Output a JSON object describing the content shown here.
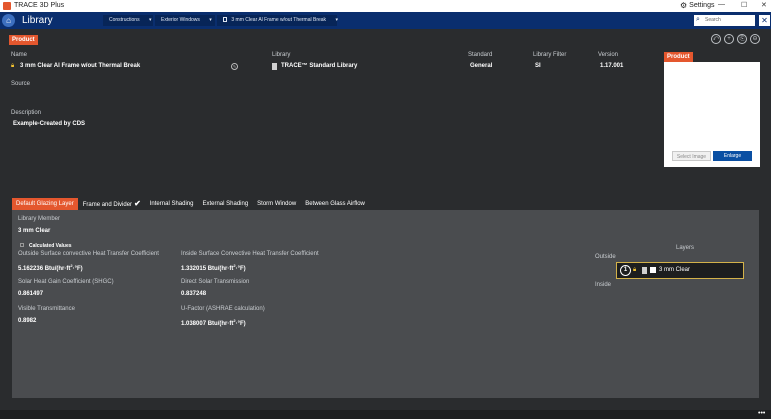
{
  "window": {
    "app_title": "TRACE 3D Plus",
    "settings_label": "Settings",
    "minimize": "—",
    "maximize": "☐",
    "close": "✕"
  },
  "header": {
    "page_title": "Library",
    "breadcrumbs": [
      {
        "label": "Constructions"
      },
      {
        "label": "Exterior Windows"
      },
      {
        "label": "3 mm Clear Al Frame w/out Thermal Break"
      }
    ],
    "search_placeholder": "Search",
    "close_label": "✕"
  },
  "product": {
    "badge": "Product",
    "name_label": "Name",
    "name_value": "3 mm Clear Al Frame w/out Thermal Break",
    "library_label": "Library",
    "library_value": "TRACE™ Standard Library",
    "standard_label": "Standard",
    "standard_value": "General",
    "filter_label": "Library Filter",
    "filter_value": "SI",
    "version_label": "Version",
    "version_value": "1.17.001",
    "source_label": "Source",
    "description_label": "Description",
    "description_value": "Example-Created by CDS",
    "image_badge": "Product",
    "select_image": "Select Image",
    "enlarge": "Enlarge"
  },
  "actions": [
    {
      "icon": "back-icon",
      "glyph": "⤺"
    },
    {
      "icon": "add-icon",
      "glyph": "+"
    },
    {
      "icon": "copy-icon",
      "glyph": "⎘"
    },
    {
      "icon": "delete-icon",
      "glyph": "⊖"
    }
  ],
  "tabs": [
    {
      "label": "Default Glazing Layer",
      "active": true
    },
    {
      "label": "Frame and Divider",
      "check": "✔"
    },
    {
      "label": "Internal Shading"
    },
    {
      "label": "External Shading"
    },
    {
      "label": "Storm Window"
    },
    {
      "label": "Between Glass Airflow"
    }
  ],
  "layer": {
    "member_label": "Library Member",
    "member_value": "3 mm Clear",
    "calculated_label": "Calculated Values",
    "outside_conv_label": "Outside Surface convective Heat Transfer Coefficient",
    "outside_conv_value": "5.162236 Btu/(hr·ft",
    "outside_conv_unit": "·°F)",
    "inside_conv_label": "Inside Surface Convective Heat Transfer Coefficient",
    "inside_conv_value": "1.332015 Btu/(hr·ft",
    "inside_conv_unit": "·°F)",
    "shgc_label": "Solar Heat Gain Coefficient (SHGC)",
    "shgc_value": "0.861497",
    "dst_label": "Direct Solar Transmission",
    "dst_value": "0.837248",
    "vt_label": "Visible Transmittance",
    "vt_value": "0.8982",
    "ufactor_label": "U-Factor (ASHRAE calculation)",
    "ufactor_value": "1.038007 Btu/(hr·ft",
    "ufactor_unit": "·°F)",
    "sup2": "2"
  },
  "layers_panel": {
    "title": "Layers",
    "outside_label": "Outside",
    "inside_label": "Inside",
    "items": [
      {
        "number": "1",
        "name": "3 mm Clear"
      }
    ]
  },
  "footer": {
    "more": "•••"
  }
}
